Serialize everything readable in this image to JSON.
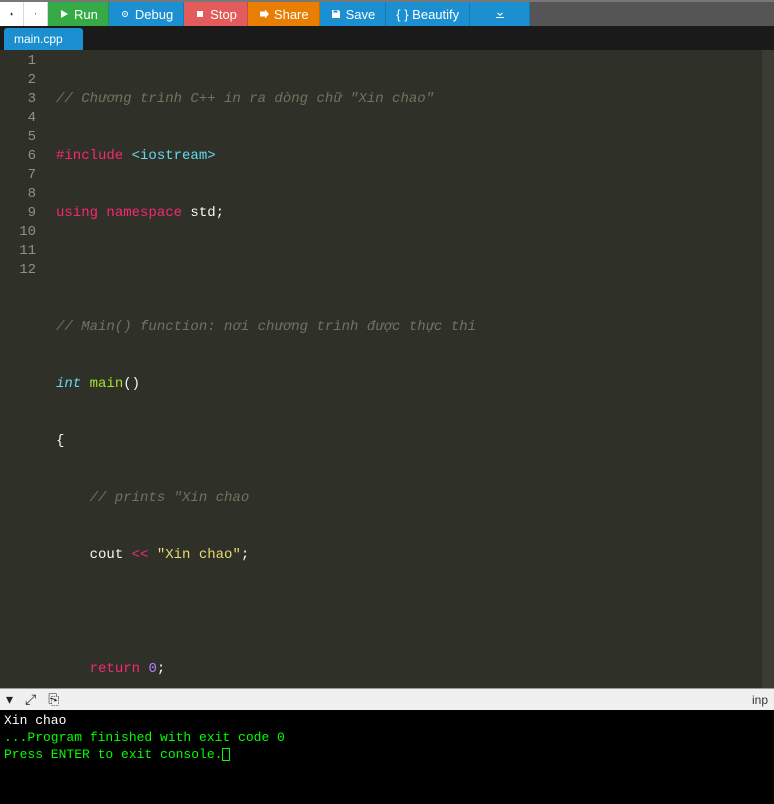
{
  "toolbar": {
    "run": "Run",
    "debug": "Debug",
    "stop": "Stop",
    "share": "Share",
    "save": "Save",
    "beautify": "{ } Beautify"
  },
  "tab": {
    "name": "main.cpp"
  },
  "gutter": [
    "1",
    "2",
    "3",
    "4",
    "5",
    "6",
    "7",
    "8",
    "9",
    "10",
    "11",
    "12"
  ],
  "code": {
    "l1_comment": "// Chương trình C++ in ra dòng chữ \"Xin chao\"",
    "l2_include": "#include",
    "l2_arg": " <iostream>",
    "l3_using": "using",
    "l3_ns": " namespace",
    "l3_std": " std",
    "l3_semi": ";",
    "l5_comment": "// Main() function: nơi chương trình được thực thi",
    "l6_int": "int",
    "l6_main": " main",
    "l6_paren": "()",
    "l7_brace": "{",
    "l8_comment": "    // prints \"Xin chao",
    "l9_indent": "    ",
    "l9_cout": "cout",
    "l9_op": " << ",
    "l9_str": "\"Xin chao\"",
    "l9_semi": ";",
    "l11_indent": "    ",
    "l11_return": "return",
    "l11_sp": " ",
    "l11_zero": "0",
    "l11_semi": ";",
    "l12_brace": "}"
  },
  "panel": {
    "right_label": "inp"
  },
  "console": {
    "out1": "Xin chao",
    "blank": "",
    "msg1": "...Program finished with exit code 0",
    "msg2": "Press ENTER to exit console."
  }
}
